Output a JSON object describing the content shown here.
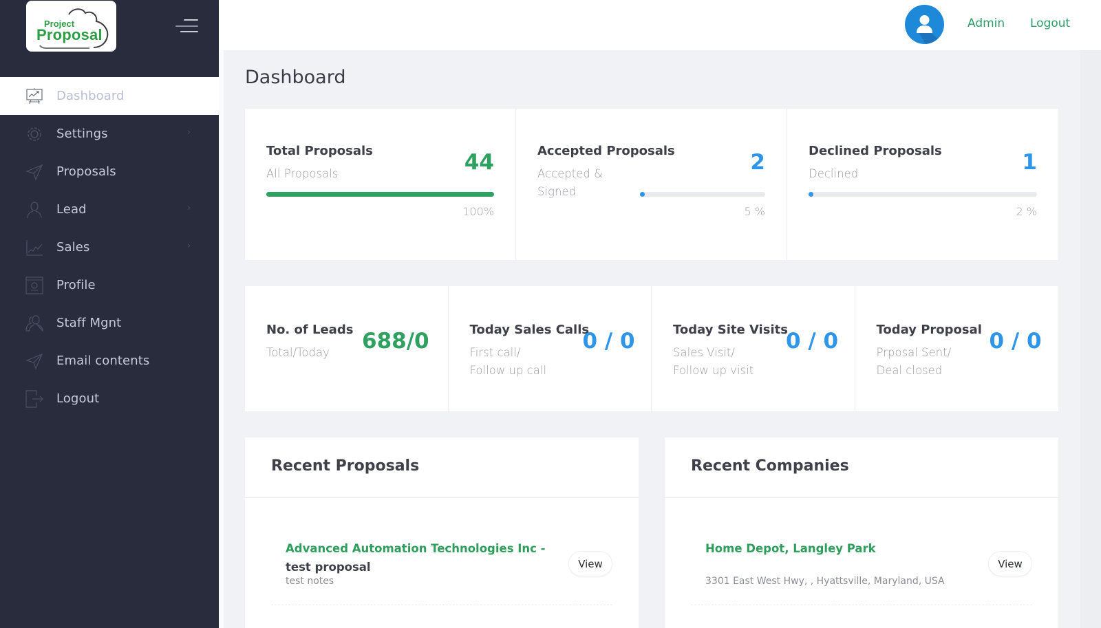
{
  "brand": {
    "logo_line1": "Project",
    "logo_line2": "Proposal"
  },
  "sidebar": {
    "items": [
      {
        "label": "Dashboard",
        "icon": "presentation-chart-icon",
        "active": true,
        "has_chevron": false
      },
      {
        "label": "Settings",
        "icon": "gear-icon",
        "active": false,
        "has_chevron": true
      },
      {
        "label": "Proposals",
        "icon": "paper-plane-icon",
        "active": false,
        "has_chevron": false
      },
      {
        "label": "Lead",
        "icon": "user-icon",
        "active": false,
        "has_chevron": true
      },
      {
        "label": "Sales",
        "icon": "area-chart-icon",
        "active": false,
        "has_chevron": true
      },
      {
        "label": "Profile",
        "icon": "profile-window-icon",
        "active": false,
        "has_chevron": false
      },
      {
        "label": "Staff Mgnt",
        "icon": "users-icon",
        "active": false,
        "has_chevron": false
      },
      {
        "label": "Email contents",
        "icon": "paper-plane-icon",
        "active": false,
        "has_chevron": false
      },
      {
        "label": "Logout",
        "icon": "logout-icon",
        "active": false,
        "has_chevron": false
      }
    ],
    "chevron": "›"
  },
  "header": {
    "user_label": "Admin",
    "logout_label": "Logout"
  },
  "page": {
    "title": "Dashboard"
  },
  "stats_row1": [
    {
      "title": "Total Proposals",
      "subtitle": "All Proposals",
      "value": "44",
      "progress_percent": 100,
      "progress_label": "100%",
      "color": "#2ea05f"
    },
    {
      "title": "Accepted Proposals",
      "subtitle": "Accepted & Signed",
      "value": "2",
      "progress_percent": 5,
      "progress_label": "5 %",
      "color": "#2f95e8"
    },
    {
      "title": "Declined Proposals",
      "subtitle": "Declined",
      "value": "1",
      "progress_percent": 2,
      "progress_label": "2 %",
      "color": "#2f95e8"
    }
  ],
  "stats_row2": [
    {
      "title": "No. of Leads",
      "subtitle_1": "Total/Today",
      "subtitle_2": "",
      "value": "688/0",
      "color": "#2ea05f"
    },
    {
      "title": "Today Sales Calls",
      "subtitle_1": "First call/",
      "subtitle_2": "Follow up call",
      "value": "0 / 0",
      "color": "#2f95e8"
    },
    {
      "title": "Today Site Visits",
      "subtitle_1": "Sales Visit/",
      "subtitle_2": "Follow up visit",
      "value": "0 / 0",
      "color": "#2f95e8"
    },
    {
      "title": "Today Proposal",
      "subtitle_1": "Prposal Sent/",
      "subtitle_2": "Deal closed",
      "value": "0 / 0",
      "color": "#2f95e8"
    }
  ],
  "recent_proposals": {
    "title": "Recent Proposals",
    "items": [
      {
        "company": "Advanced Automation Technologies Inc -",
        "proposal": "test proposal",
        "notes": "test notes",
        "button": "View"
      }
    ]
  },
  "recent_companies": {
    "title": "Recent Companies",
    "items": [
      {
        "name": "Home Depot, Langley Park",
        "address": "3301 East West Hwy, , Hyattsville, Maryland, USA",
        "button": "View"
      }
    ]
  }
}
